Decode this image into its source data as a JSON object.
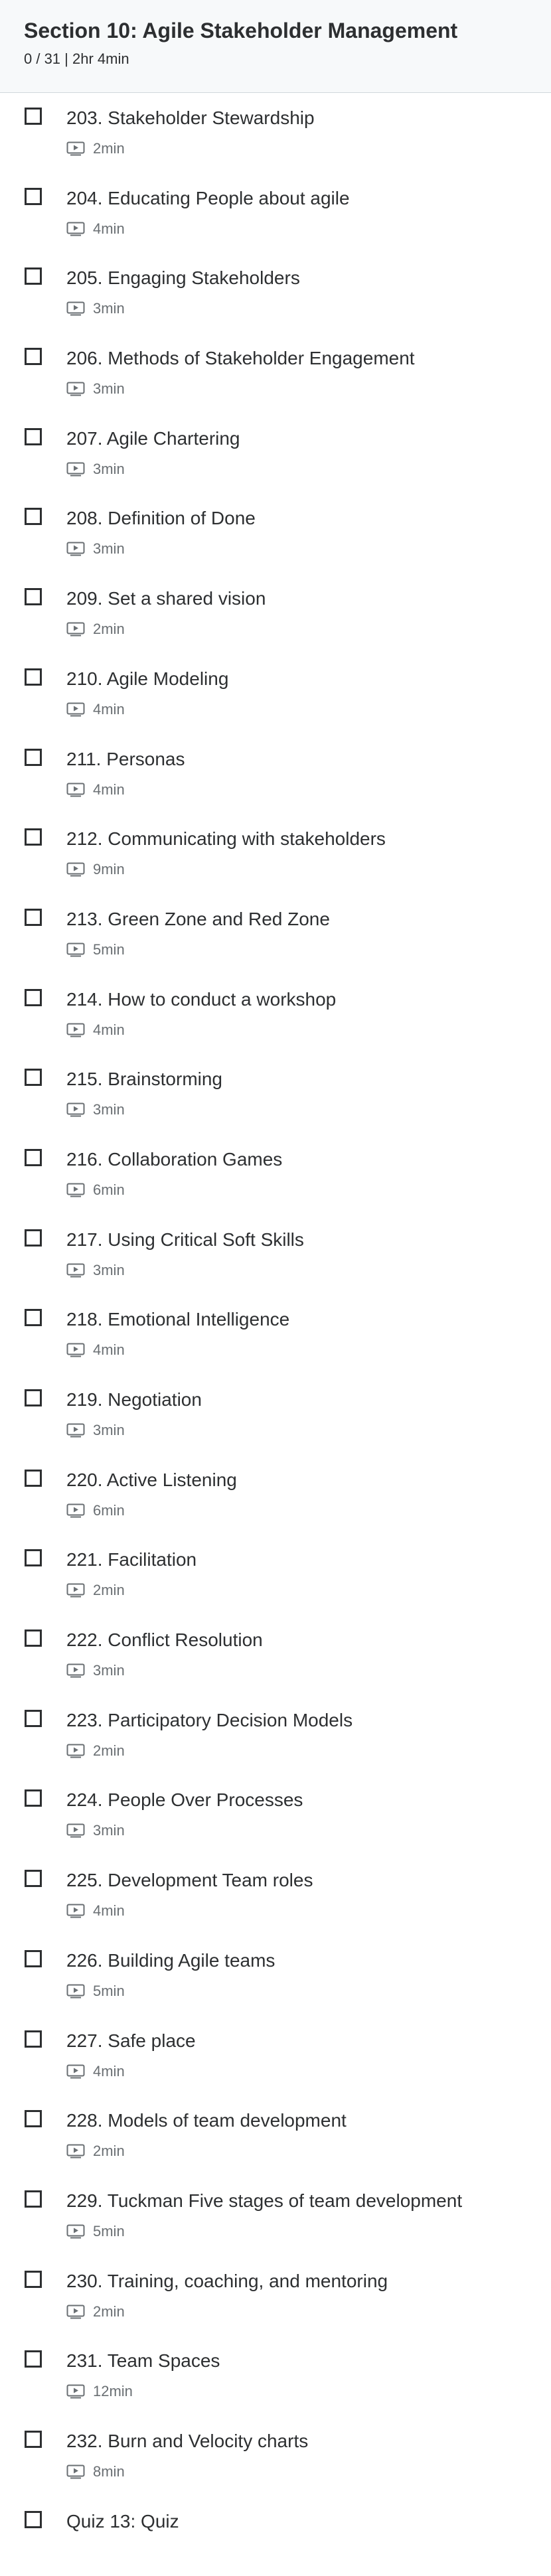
{
  "section": {
    "title": "Section 10: Agile Stakeholder Management",
    "meta": "0 / 31 | 2hr 4min"
  },
  "lectures": [
    {
      "title": "203. Stakeholder Stewardship",
      "duration": "2min"
    },
    {
      "title": "204. Educating People about agile",
      "duration": "4min"
    },
    {
      "title": "205. Engaging Stakeholders",
      "duration": "3min"
    },
    {
      "title": "206. Methods of Stakeholder Engagement",
      "duration": "3min"
    },
    {
      "title": "207. Agile Chartering",
      "duration": "3min"
    },
    {
      "title": "208. Definition of Done",
      "duration": "3min"
    },
    {
      "title": "209. Set a shared vision",
      "duration": "2min"
    },
    {
      "title": "210. Agile Modeling",
      "duration": "4min"
    },
    {
      "title": "211. Personas",
      "duration": "4min"
    },
    {
      "title": "212. Communicating with stakeholders",
      "duration": "9min"
    },
    {
      "title": "213. Green Zone and Red Zone",
      "duration": "5min"
    },
    {
      "title": "214. How to conduct a workshop",
      "duration": "4min"
    },
    {
      "title": "215. Brainstorming",
      "duration": "3min"
    },
    {
      "title": "216. Collaboration Games",
      "duration": "6min"
    },
    {
      "title": "217. Using Critical Soft Skills",
      "duration": "3min"
    },
    {
      "title": "218. Emotional Intelligence",
      "duration": "4min"
    },
    {
      "title": "219. Negotiation",
      "duration": "3min"
    },
    {
      "title": "220. Active Listening",
      "duration": "6min"
    },
    {
      "title": "221. Facilitation",
      "duration": "2min"
    },
    {
      "title": "222. Conflict Resolution",
      "duration": "3min"
    },
    {
      "title": "223. Participatory Decision Models",
      "duration": "2min"
    },
    {
      "title": "224. People Over Processes",
      "duration": "3min"
    },
    {
      "title": "225. Development Team roles",
      "duration": "4min"
    },
    {
      "title": "226. Building Agile teams",
      "duration": "5min"
    },
    {
      "title": "227. Safe place",
      "duration": "4min"
    },
    {
      "title": "228. Models of team development",
      "duration": "2min"
    },
    {
      "title": "229. Tuckman Five stages of team development",
      "duration": "5min"
    },
    {
      "title": "230. Training, coaching, and mentoring",
      "duration": "2min"
    },
    {
      "title": "231. Team Spaces",
      "duration": "12min"
    },
    {
      "title": "232. Burn and Velocity charts",
      "duration": "8min"
    }
  ],
  "quiz": {
    "title": "Quiz 13: Quiz"
  },
  "icons": {
    "lecture": "video-play-icon",
    "checkbox": "checkbox-icon"
  }
}
